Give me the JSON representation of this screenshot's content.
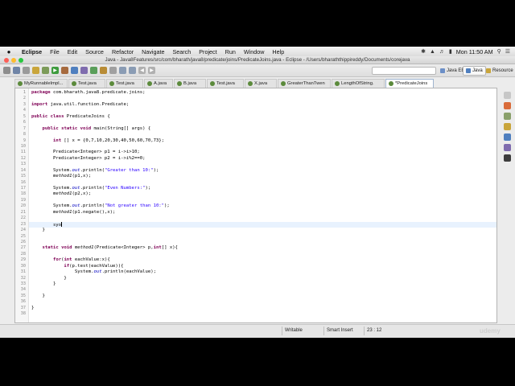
{
  "menubar": {
    "items": [
      "Eclipse",
      "File",
      "Edit",
      "Source",
      "Refactor",
      "Navigate",
      "Search",
      "Project",
      "Run",
      "Window",
      "Help"
    ],
    "clock": "Mon 11:50 AM"
  },
  "window": {
    "title": "Java - Java8Features/src/com/bharath/java8/predicate/joins/PredicateJoins.java - Eclipse - /Users/bharaththippireddy/Documents/corejava"
  },
  "toolbar": {
    "perspectives": [
      {
        "label": "Java EE",
        "active": false
      },
      {
        "label": "Java",
        "active": true
      },
      {
        "label": "Resource",
        "active": false
      }
    ]
  },
  "tabs": [
    {
      "label": "MyRunnableImpl...",
      "active": false
    },
    {
      "label": "Test.java",
      "active": false
    },
    {
      "label": "Test.java",
      "active": false
    },
    {
      "label": "A.java",
      "active": false
    },
    {
      "label": "B.java",
      "active": false
    },
    {
      "label": "Test.java",
      "active": false
    },
    {
      "label": "X.java",
      "active": false
    },
    {
      "label": "GreaterThanTwen",
      "active": false
    },
    {
      "label": "LengthOfString.",
      "active": false
    },
    {
      "label": "*PredicateJoins",
      "active": true
    }
  ],
  "editor": {
    "current_line": 23,
    "lines": [
      {
        "n": "1",
        "text": "package com.bharath.java8.predicate.joins;"
      },
      {
        "n": "2",
        "text": ""
      },
      {
        "n": "3",
        "text": "import java.util.function.Predicate;"
      },
      {
        "n": "4",
        "text": ""
      },
      {
        "n": "5",
        "text": "public class PredicateJoins {"
      },
      {
        "n": "6",
        "text": ""
      },
      {
        "n": "7",
        "text": "    public static void main(String[] args) {"
      },
      {
        "n": "8",
        "text": ""
      },
      {
        "n": "9",
        "text": "        int [] x = {0,7,10,20,30,40,50,60,70,73};"
      },
      {
        "n": "10",
        "text": ""
      },
      {
        "n": "11",
        "text": "        Predicate<Integer> p1 = i->i>10;"
      },
      {
        "n": "12",
        "text": "        Predicate<Integer> p2 = i->i%2==0;"
      },
      {
        "n": "13",
        "text": ""
      },
      {
        "n": "14",
        "text": "        System.out.println(\"Greater than 10:\");"
      },
      {
        "n": "15",
        "text": "        method1(p1,x);"
      },
      {
        "n": "16",
        "text": ""
      },
      {
        "n": "17",
        "text": "        System.out.println(\"Even Numbers:\");"
      },
      {
        "n": "18",
        "text": "        method1(p2,x);"
      },
      {
        "n": "19",
        "text": ""
      },
      {
        "n": "20",
        "text": "        System.out.println(\"Not greater than 10:\");"
      },
      {
        "n": "21",
        "text": "        method1(p1.negate(),x);"
      },
      {
        "n": "22",
        "text": ""
      },
      {
        "n": "23",
        "text": "        syo"
      },
      {
        "n": "24",
        "text": "    }"
      },
      {
        "n": "25",
        "text": ""
      },
      {
        "n": "26",
        "text": ""
      },
      {
        "n": "27",
        "text": "    static void method1(Predicate<Integer> p,int[] x){"
      },
      {
        "n": "28",
        "text": ""
      },
      {
        "n": "29",
        "text": "        for(int eachValue:x){"
      },
      {
        "n": "30",
        "text": "            if(p.test(eachValue)){"
      },
      {
        "n": "31",
        "text": "                System.out.println(eachValue);"
      },
      {
        "n": "32",
        "text": "            }"
      },
      {
        "n": "33",
        "text": "        }"
      },
      {
        "n": "34",
        "text": ""
      },
      {
        "n": "35",
        "text": "    }"
      },
      {
        "n": "36",
        "text": ""
      },
      {
        "n": "37",
        "text": "}"
      },
      {
        "n": "38",
        "text": ""
      }
    ]
  },
  "statusbar": {
    "mode": "Writable",
    "insert": "Smart Insert",
    "position": "23 : 12"
  },
  "colors": {
    "keyword": "#7f0055",
    "string": "#2a00ff",
    "field": "#0000c0",
    "current_line": "#e8f2fe",
    "active_tab_border": "#9fb4cf"
  },
  "watermark": "udemy"
}
